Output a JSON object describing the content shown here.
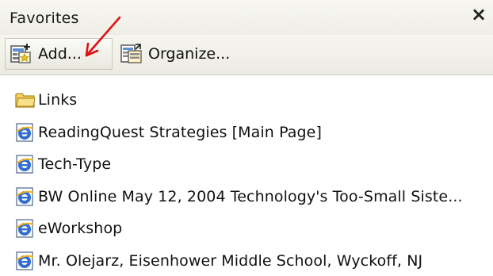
{
  "panel": {
    "title": "Favorites",
    "close_glyph": "×"
  },
  "toolbar": {
    "add_label": "Add...",
    "add_icon": "add-favorite-icon",
    "organize_label": "Organize...",
    "organize_icon": "organize-favorites-icon"
  },
  "annotation": {
    "color": "#e01010"
  },
  "favorites": [
    {
      "label": "Links",
      "icon": "folder-icon"
    },
    {
      "label": "ReadingQuest  Strategies [Main Page]",
      "icon": "ie-page-icon"
    },
    {
      "label": "Tech-Type",
      "icon": "ie-page-icon"
    },
    {
      "label": "BW Online  May 12, 2004  Technology's Too-Small Siste...",
      "icon": "ie-page-icon"
    },
    {
      "label": "eWorkshop",
      "icon": "ie-page-icon"
    },
    {
      "label": "Mr. Olejarz, Eisenhower Middle School, Wyckoff, NJ",
      "icon": "ie-page-icon"
    }
  ]
}
